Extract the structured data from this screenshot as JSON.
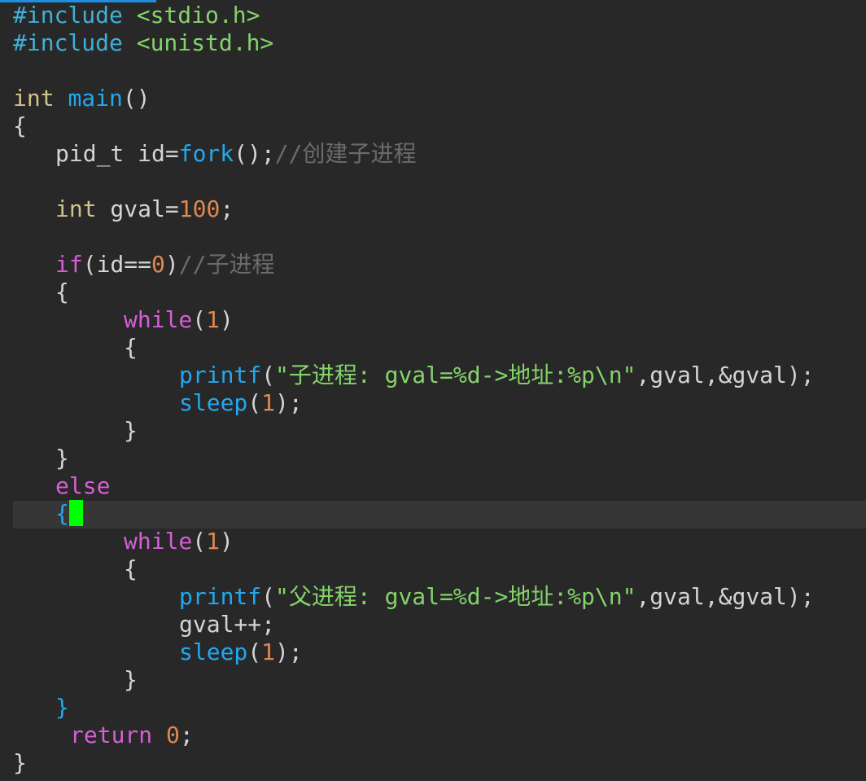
{
  "editor": {
    "lines": {
      "l1": {
        "kw": "#include",
        "arg": "<stdio.h>"
      },
      "l2": {
        "kw": "#include",
        "arg": "<unistd.h>"
      },
      "l4": {
        "type": "int",
        "name": "main",
        "paren": "()"
      },
      "l5": {
        "brace": "{"
      },
      "l6": {
        "pre": "pid_t id=",
        "fn": "fork",
        "post": "();",
        "comment": "//创建子进程"
      },
      "l8": {
        "type": "int",
        "pre": " gval=",
        "num": "100",
        "post": ";"
      },
      "l10": {
        "kw": "if",
        "pre": "(id==",
        "num": "0",
        "post": ")",
        "comment": "//子进程"
      },
      "l11": {
        "brace": "{"
      },
      "l12": {
        "kw": "while",
        "pre": "(",
        "num": "1",
        "post": ")"
      },
      "l13": {
        "brace": "{"
      },
      "l14": {
        "fn": "printf",
        "open": "(",
        "str": "\"子进程: gval=%d->地址:%p\\n\"",
        "post": ",gval,&gval);"
      },
      "l15": {
        "fn": "sleep",
        "pre": "(",
        "num": "1",
        "post": ");"
      },
      "l16": {
        "brace": "}"
      },
      "l17": {
        "brace": "}"
      },
      "l18": {
        "kw": "else"
      },
      "l19": {
        "brace": "{"
      },
      "l20": {
        "kw": "while",
        "pre": "(",
        "num": "1",
        "post": ")"
      },
      "l21": {
        "brace": "{"
      },
      "l22": {
        "fn": "printf",
        "open": "(",
        "str": "\"父进程: gval=%d->地址:%p\\n\"",
        "post": ",gval,&gval);"
      },
      "l23": {
        "text": "gval++;"
      },
      "l24": {
        "fn": "sleep",
        "pre": "(",
        "num": "1",
        "post": ");"
      },
      "l25": {
        "brace": "}"
      },
      "l26": {
        "brace": "}"
      },
      "l27": {
        "kw": "return",
        "pre": " ",
        "num": "0",
        "post": ";"
      },
      "l28": {
        "brace": "}"
      }
    }
  },
  "colors": {
    "background": "#282828",
    "cursor": "#00ff00",
    "keyword": "#d45fd6",
    "function": "#22a8ef",
    "type": "#d2c28e",
    "number": "#e0884d",
    "string": "#84d36b",
    "comment": "#6b6b6b"
  }
}
